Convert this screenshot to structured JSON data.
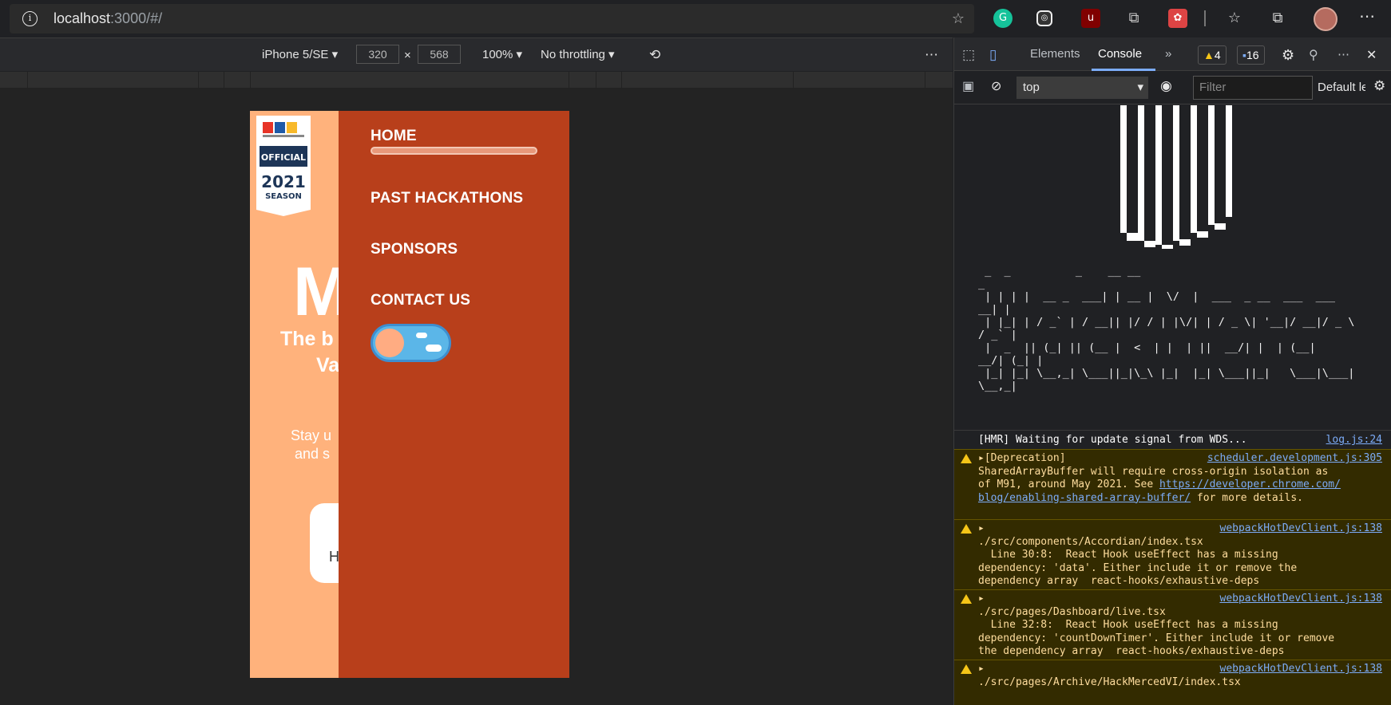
{
  "browser": {
    "url_host": "localhost",
    "url_rest": ":3000/#/"
  },
  "device_toolbar": {
    "device": "iPhone 5/SE",
    "width": "320",
    "height": "568",
    "zoom": "100%",
    "throttling": "No throttling"
  },
  "page": {
    "badge_official": "OFFICIAL",
    "badge_year": "2021",
    "badge_season": "SEASON",
    "hero_letter": "M",
    "hero_line1": "The b",
    "hero_line2": "Va",
    "stay_line1": "Stay u",
    "stay_line2": "and s",
    "card_letter": "H",
    "nav": [
      "HOME",
      "PAST HACKATHONS",
      "SPONSORS",
      "CONTACT US"
    ]
  },
  "devtools": {
    "tabs": [
      "Elements",
      "Console"
    ],
    "warn_count": "4",
    "msg_count": "16",
    "context": "top",
    "filter_placeholder": "Filter",
    "levels": "Default levels",
    "hmr": "[HMR] Waiting for update signal from WDS...",
    "hmr_src": "log.js:24",
    "warnings": [
      {
        "src": "scheduler.development.js:305",
        "lines": [
          "[Deprecation]",
          "SharedArrayBuffer will require cross-origin isolation as",
          "of M91, around May 2021. See ",
          "https://developer.chrome.com/",
          "blog/enabling-shared-array-buffer/",
          " for more details."
        ]
      },
      {
        "src": "webpackHotDevClient.js:138",
        "lines": [
          "./src/components/Accordian/index.tsx",
          "  Line 30:8:  React Hook useEffect has a missing",
          "dependency: 'data'. Either include it or remove the",
          "dependency array  react-hooks/exhaustive-deps"
        ]
      },
      {
        "src": "webpackHotDevClient.js:138",
        "lines": [
          "./src/pages/Dashboard/live.tsx",
          "  Line 32:8:  React Hook useEffect has a missing",
          "dependency: 'countDownTimer'. Either include it or remove",
          "the dependency array  react-hooks/exhaustive-deps"
        ]
      },
      {
        "src": "webpackHotDevClient.js:138",
        "lines": [
          "./src/pages/Archive/HackMercedVI/index.tsx"
        ]
      }
    ]
  }
}
